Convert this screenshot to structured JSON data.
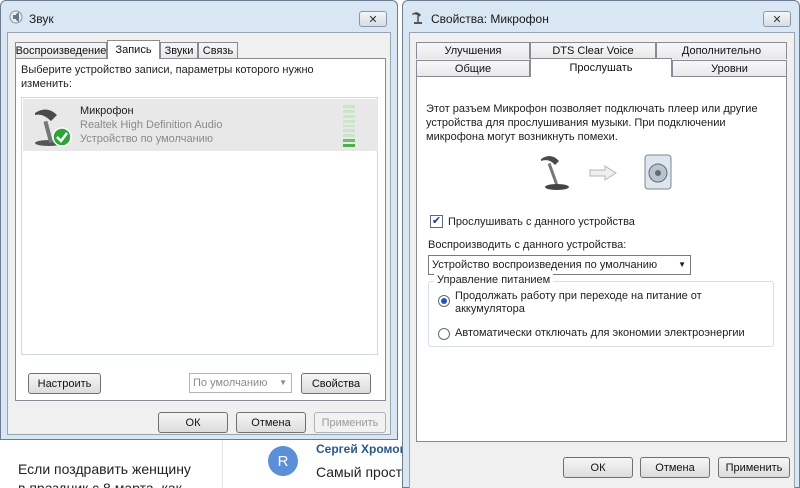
{
  "background": {
    "post_text_line1": "Если поздравить женщину",
    "post_text_line2": "в праздник с 8 марта, как",
    "comment_avatar_letter": "R",
    "comment_author": "Сергей Хромов",
    "comment_text": "Самый простой"
  },
  "sound_window": {
    "title": "Звук",
    "close_label": "✕",
    "tabs": [
      "Воспроизведение",
      "Запись",
      "Звуки",
      "Связь"
    ],
    "active_tab": "Запись",
    "instruction": "Выберите устройство записи, параметры которого нужно изменить:",
    "device": {
      "name": "Микрофон",
      "driver": "Realtek High Definition Audio",
      "status": "Устройство по умолчанию"
    },
    "configure_button": "Настроить",
    "default_dropdown": "По умолчанию",
    "properties_button": "Свойства",
    "ok": "ОК",
    "cancel": "Отмена",
    "apply": "Применить"
  },
  "props_window": {
    "title": "Свойства: Микрофон",
    "close_label": "✕",
    "tabs_row1": [
      "Улучшения",
      "DTS Clear Voice",
      "Дополнительно"
    ],
    "tabs_row2": [
      "Общие",
      "Прослушать",
      "Уровни"
    ],
    "active_tab": "Прослушать",
    "description": "Этот разъем Микрофон позволяет подключать плеер или другие устройства для прослушивания музыки. При подключении микрофона могут возникнуть помехи.",
    "listen_checkbox": "Прослушивать с данного устройства",
    "listen_checked": true,
    "playback_label": "Воспроизводить с данного устройства:",
    "playback_value": "Устройство воспроизведения по умолчанию",
    "power_group": "Управление питанием",
    "radio1": "Продолжать работу при переходе на питание от аккумулятора",
    "radio2": "Автоматически отключать для экономии электроэнергии",
    "selected_radio": 1,
    "ok": "ОК",
    "cancel": "Отмена",
    "apply": "Применить"
  }
}
